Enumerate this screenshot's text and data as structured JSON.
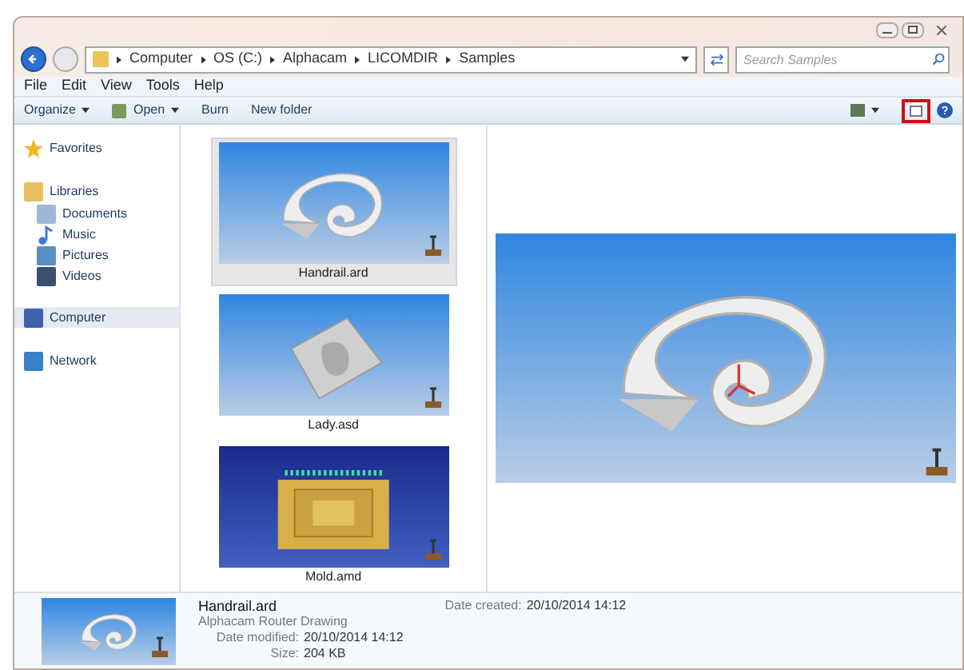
{
  "address": {
    "crumbs": [
      "Computer",
      "OS (C:)",
      "Alphacam",
      "LICOMDIR",
      "Samples"
    ]
  },
  "search": {
    "placeholder": "Search Samples"
  },
  "menu": [
    "File",
    "Edit",
    "View",
    "Tools",
    "Help"
  ],
  "toolbar": [
    {
      "label": "Organize",
      "kind": "dropdown"
    },
    {
      "label": "Open",
      "kind": "icon-dropdown"
    },
    {
      "label": "Burn",
      "kind": "plain"
    },
    {
      "label": "New folder",
      "kind": "plain"
    }
  ],
  "preview_button": {
    "highlighted": true
  },
  "sidebar": [
    {
      "label": "Favorites",
      "kind": "favorites",
      "selected": false
    },
    {
      "label": "Libraries",
      "kind": "libraries",
      "selected": false,
      "children": [
        {
          "label": "Documents",
          "kind": "documents",
          "selected": false
        },
        {
          "label": "Music",
          "kind": "music",
          "selected": false
        },
        {
          "label": "Pictures",
          "kind": "pictures",
          "selected": false
        },
        {
          "label": "Videos",
          "kind": "videos",
          "selected": false
        }
      ]
    },
    {
      "label": "Computer",
      "kind": "computer",
      "selected": true
    },
    {
      "label": "Network",
      "kind": "network",
      "selected": false
    }
  ],
  "files": [
    {
      "name": "Handrail.ard",
      "kind": "handrail",
      "selected": true
    },
    {
      "name": "Lady.asd",
      "kind": "lady",
      "selected": false
    },
    {
      "name": "Mold.amd",
      "kind": "mold",
      "selected": false
    }
  ],
  "details": {
    "name": "Handrail.ard",
    "type": "Alphacam Router Drawing",
    "fields": [
      {
        "label": "Date modified:",
        "value": "20/10/2014 14:12"
      },
      {
        "label": "Size:",
        "value": "204 KB"
      }
    ],
    "side_fields": [
      {
        "label": "Date created:",
        "value": "20/10/2014 14:12"
      }
    ]
  }
}
